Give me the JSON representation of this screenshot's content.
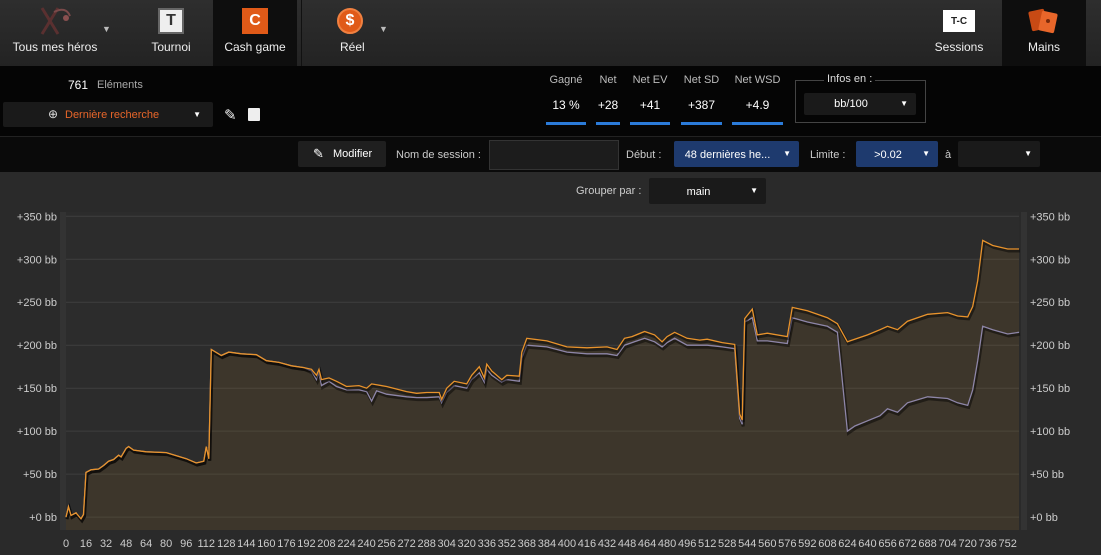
{
  "nav": {
    "heroes": "Tous mes héros",
    "tournoi": "Tournoi",
    "cash": "Cash game",
    "reel": "Réel",
    "sessions": "Sessions",
    "mains": "Mains",
    "tournoi_icon_letter": "T",
    "cash_icon_letter": "C",
    "reel_icon_symbol": "$",
    "sessions_icon_text": "T-C"
  },
  "summary": {
    "count": "761",
    "count_label": "Eléments",
    "search": "Dernière recherche"
  },
  "stats": [
    {
      "label": "Gagné",
      "value": "13 %"
    },
    {
      "label": "Net",
      "value": "+28"
    },
    {
      "label": "Net EV",
      "value": "+41"
    },
    {
      "label": "Net SD",
      "value": "+387"
    },
    {
      "label": "Net WSD",
      "value": "+4.9"
    }
  ],
  "infos": {
    "label": "Infos en :",
    "value": "bb/100"
  },
  "filters": {
    "modify": "Modifier",
    "session_label": "Nom de session :",
    "start_label": "Début :",
    "start_value": "48 dernières he...",
    "limit_label": "Limite :",
    "limit_value": ">0.02",
    "to_label": "à",
    "group_label": "Grouper par :",
    "group_value": "main"
  },
  "colors": {
    "accent": "#e8932c",
    "blue": "#2b7bd9",
    "ev_line": "#8e86a8"
  },
  "chart_data": {
    "type": "line",
    "title": "",
    "ylabel": "",
    "xlabel": "",
    "ylim": [
      -15,
      355
    ],
    "xlim": [
      0,
      761
    ],
    "yticks": [
      0,
      50,
      100,
      150,
      200,
      250,
      300,
      350
    ],
    "ytick_labels": [
      "+0 bb",
      "+50 bb",
      "+100 bb",
      "+150 bb",
      "+200 bb",
      "+250 bb",
      "+300 bb",
      "+350 bb"
    ],
    "xticks": [
      0,
      16,
      32,
      48,
      64,
      80,
      96,
      112,
      128,
      144,
      160,
      176,
      192,
      208,
      224,
      240,
      256,
      272,
      288,
      304,
      320,
      336,
      352,
      368,
      384,
      400,
      416,
      432,
      448,
      464,
      480,
      496,
      512,
      528,
      544,
      560,
      576,
      592,
      608,
      624,
      640,
      656,
      672,
      688,
      704,
      720,
      736,
      752
    ],
    "series": [
      {
        "points": [
          [
            0,
            0
          ],
          [
            2,
            12
          ],
          [
            4,
            2
          ],
          [
            8,
            5
          ],
          [
            12,
            -2
          ],
          [
            14,
            3
          ],
          [
            16,
            52
          ],
          [
            20,
            55
          ],
          [
            26,
            56
          ],
          [
            30,
            60
          ],
          [
            34,
            65
          ],
          [
            38,
            67
          ],
          [
            42,
            72
          ],
          [
            44,
            70
          ],
          [
            48,
            80
          ],
          [
            50,
            82
          ],
          [
            54,
            78
          ],
          [
            64,
            76
          ],
          [
            80,
            75
          ],
          [
            96,
            68
          ],
          [
            104,
            63
          ],
          [
            110,
            65
          ],
          [
            112,
            82
          ],
          [
            114,
            68
          ],
          [
            116,
            195
          ],
          [
            124,
            188
          ],
          [
            130,
            192
          ],
          [
            140,
            190
          ],
          [
            152,
            189
          ],
          [
            160,
            182
          ],
          [
            170,
            180
          ],
          [
            180,
            176
          ],
          [
            190,
            174
          ],
          [
            196,
            172
          ],
          [
            200,
            165
          ],
          [
            202,
            172
          ],
          [
            204,
            160
          ],
          [
            210,
            162
          ],
          [
            216,
            158
          ],
          [
            224,
            152
          ],
          [
            234,
            153
          ],
          [
            240,
            150
          ],
          [
            244,
            155
          ],
          [
            256,
            152
          ],
          [
            272,
            146
          ],
          [
            280,
            144
          ],
          [
            288,
            145
          ],
          [
            298,
            145
          ],
          [
            300,
            137
          ],
          [
            304,
            150
          ],
          [
            310,
            158
          ],
          [
            320,
            155
          ],
          [
            324,
            165
          ],
          [
            330,
            175
          ],
          [
            334,
            162
          ],
          [
            336,
            178
          ],
          [
            340,
            170
          ],
          [
            348,
            160
          ],
          [
            352,
            165
          ],
          [
            362,
            164
          ],
          [
            364,
            192
          ],
          [
            368,
            208
          ],
          [
            384,
            205
          ],
          [
            400,
            198
          ],
          [
            416,
            197
          ],
          [
            432,
            198
          ],
          [
            440,
            195
          ],
          [
            446,
            208
          ],
          [
            452,
            210
          ],
          [
            462,
            216
          ],
          [
            470,
            212
          ],
          [
            476,
            204
          ],
          [
            480,
            210
          ],
          [
            486,
            215
          ],
          [
            496,
            208
          ],
          [
            506,
            206
          ],
          [
            512,
            207
          ],
          [
            524,
            203
          ],
          [
            534,
            201
          ],
          [
            538,
            120
          ],
          [
            540,
            113
          ],
          [
            542,
            231
          ],
          [
            548,
            242
          ],
          [
            552,
            212
          ],
          [
            560,
            214
          ],
          [
            576,
            210
          ],
          [
            580,
            244
          ],
          [
            592,
            240
          ],
          [
            608,
            232
          ],
          [
            616,
            225
          ],
          [
            624,
            204
          ],
          [
            626,
            205
          ],
          [
            640,
            212
          ],
          [
            650,
            218
          ],
          [
            656,
            222
          ],
          [
            664,
            218
          ],
          [
            672,
            228
          ],
          [
            688,
            236
          ],
          [
            704,
            238
          ],
          [
            712,
            234
          ],
          [
            720,
            233
          ],
          [
            724,
            245
          ],
          [
            728,
            275
          ],
          [
            732,
            322
          ],
          [
            740,
            316
          ],
          [
            752,
            312
          ],
          [
            761,
            312
          ]
        ]
      },
      {
        "points": [
          [
            0,
            0
          ],
          [
            2,
            12
          ],
          [
            4,
            2
          ],
          [
            8,
            5
          ],
          [
            12,
            -2
          ],
          [
            14,
            3
          ],
          [
            16,
            52
          ],
          [
            20,
            55
          ],
          [
            26,
            56
          ],
          [
            30,
            60
          ],
          [
            34,
            65
          ],
          [
            38,
            67
          ],
          [
            42,
            72
          ],
          [
            44,
            70
          ],
          [
            48,
            80
          ],
          [
            50,
            82
          ],
          [
            54,
            78
          ],
          [
            64,
            76
          ],
          [
            80,
            75
          ],
          [
            96,
            68
          ],
          [
            104,
            63
          ],
          [
            110,
            65
          ],
          [
            112,
            82
          ],
          [
            114,
            68
          ],
          [
            116,
            195
          ],
          [
            124,
            188
          ],
          [
            130,
            192
          ],
          [
            140,
            190
          ],
          [
            152,
            189
          ],
          [
            160,
            182
          ],
          [
            170,
            180
          ],
          [
            180,
            176
          ],
          [
            190,
            174
          ],
          [
            196,
            170
          ],
          [
            200,
            160
          ],
          [
            202,
            168
          ],
          [
            204,
            153
          ],
          [
            210,
            158
          ],
          [
            216,
            152
          ],
          [
            224,
            148
          ],
          [
            234,
            148
          ],
          [
            240,
            146
          ],
          [
            244,
            135
          ],
          [
            248,
            147
          ],
          [
            256,
            143
          ],
          [
            272,
            140
          ],
          [
            280,
            139
          ],
          [
            288,
            139
          ],
          [
            298,
            140
          ],
          [
            300,
            133
          ],
          [
            304,
            145
          ],
          [
            310,
            153
          ],
          [
            320,
            150
          ],
          [
            324,
            160
          ],
          [
            330,
            168
          ],
          [
            334,
            157
          ],
          [
            336,
            172
          ],
          [
            340,
            165
          ],
          [
            348,
            157
          ],
          [
            352,
            160
          ],
          [
            362,
            158
          ],
          [
            364,
            185
          ],
          [
            368,
            200
          ],
          [
            384,
            198
          ],
          [
            400,
            192
          ],
          [
            416,
            190
          ],
          [
            432,
            190
          ],
          [
            440,
            188
          ],
          [
            446,
            200
          ],
          [
            452,
            203
          ],
          [
            462,
            208
          ],
          [
            470,
            204
          ],
          [
            476,
            198
          ],
          [
            480,
            203
          ],
          [
            486,
            208
          ],
          [
            496,
            200
          ],
          [
            506,
            200
          ],
          [
            512,
            200
          ],
          [
            524,
            198
          ],
          [
            534,
            196
          ],
          [
            538,
            115
          ],
          [
            540,
            108
          ],
          [
            542,
            227
          ],
          [
            548,
            232
          ],
          [
            552,
            205
          ],
          [
            560,
            205
          ],
          [
            576,
            202
          ],
          [
            580,
            232
          ],
          [
            592,
            227
          ],
          [
            608,
            222
          ],
          [
            616,
            215
          ],
          [
            624,
            100
          ],
          [
            630,
            106
          ],
          [
            640,
            112
          ],
          [
            650,
            118
          ],
          [
            656,
            126
          ],
          [
            664,
            122
          ],
          [
            672,
            133
          ],
          [
            688,
            140
          ],
          [
            704,
            138
          ],
          [
            712,
            133
          ],
          [
            720,
            130
          ],
          [
            724,
            148
          ],
          [
            728,
            182
          ],
          [
            732,
            222
          ],
          [
            740,
            218
          ],
          [
            752,
            213
          ],
          [
            761,
            215
          ]
        ]
      }
    ]
  }
}
